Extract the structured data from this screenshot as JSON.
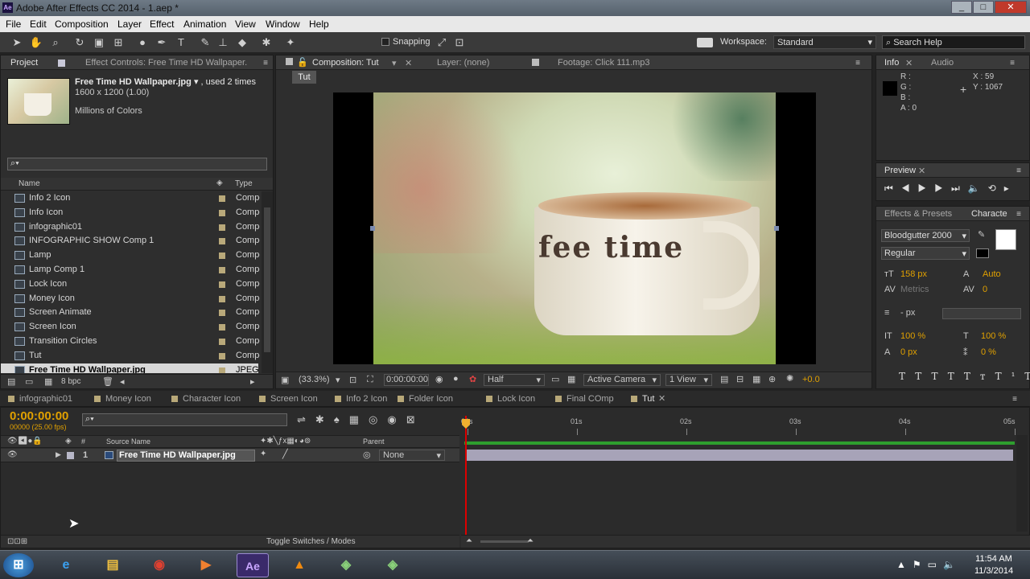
{
  "window": {
    "title": "Adobe After Effects CC 2014 - 1.aep *",
    "app_badge": "Ae"
  },
  "menu": [
    "File",
    "Edit",
    "Composition",
    "Layer",
    "Effect",
    "Animation",
    "View",
    "Window",
    "Help"
  ],
  "toolbar": {
    "snapping": "Snapping",
    "workspace_label": "Workspace:",
    "workspace_value": "Standard",
    "search_placeholder": "Search Help"
  },
  "project_panel": {
    "tabs": [
      "Project",
      "Effect Controls: Free Time HD Wallpaper."
    ],
    "asset": {
      "name": "Free Time HD Wallpaper.jpg",
      "usage": ", used 2 times",
      "dimensions": "1600 x 1200 (1.00)",
      "colors": "Millions of Colors"
    },
    "columns": {
      "name": "Name",
      "type": "Type"
    },
    "items": [
      {
        "name": "Info 2 Icon",
        "type": "Compo"
      },
      {
        "name": "Info Icon",
        "type": "Compo"
      },
      {
        "name": "infographic01",
        "type": "Compo"
      },
      {
        "name": "INFOGRAPHIC SHOW Comp 1",
        "type": "Compo"
      },
      {
        "name": "Lamp",
        "type": "Compo"
      },
      {
        "name": "Lamp Comp 1",
        "type": "Compo"
      },
      {
        "name": "Lock Icon",
        "type": "Compo"
      },
      {
        "name": "Money Icon",
        "type": "Compo"
      },
      {
        "name": "Screen Animate",
        "type": "Compo"
      },
      {
        "name": "Screen Icon",
        "type": "Compo"
      },
      {
        "name": "Transition Circles",
        "type": "Compo"
      },
      {
        "name": "Tut",
        "type": "Compo"
      },
      {
        "name": "Free Time HD Wallpaper.jpg",
        "type": "JPEG"
      }
    ],
    "bpc": "8 bpc"
  },
  "comp_panel": {
    "tabs": [
      "Composition: Tut",
      "Layer: (none)",
      "Footage: Click 111.mp3"
    ],
    "crumb": "Tut",
    "image_text": "fee time",
    "zoom": "(33.3%)",
    "timecode": "0:00:00:00",
    "resolution": "Half",
    "camera": "Active Camera",
    "view": "1 View",
    "exposure": "+0.0"
  },
  "info_panel": {
    "tabs": [
      "Info",
      "Audio"
    ],
    "r": "R :",
    "g": "G :",
    "b": "B :",
    "a": "A : 0",
    "x": "X : 59",
    "y": "Y : 1067"
  },
  "preview_panel": {
    "tab": "Preview"
  },
  "character_panel": {
    "tabs": [
      "Effects & Presets",
      "Characte"
    ],
    "font": "Bloodgutter 2000",
    "style": "Regular",
    "size": "158 px",
    "leading": "Auto",
    "kerning": "Metrics",
    "tracking": "0",
    "stroke": "- px",
    "vscale": "100 %",
    "hscale": "100 %",
    "baseline": "0 px",
    "tsume": "0 %"
  },
  "timeline": {
    "tabs": [
      "infographic01",
      "Money Icon",
      "Character Icon",
      "Screen Icon",
      "Info 2 Icon",
      "Folder Icon",
      "Lock Icon",
      "Final COmp",
      "Tut"
    ],
    "timecode": "0:00:00:00",
    "frames": "00000 (25.00 fps)",
    "col_source": "Source Name",
    "col_parent": "Parent",
    "layer": {
      "num": "1",
      "name": "Free Time HD Wallpaper.jpg",
      "parent": "None"
    },
    "ruler": [
      "00s",
      "01s",
      "02s",
      "03s",
      "04s",
      "05s"
    ],
    "toggle": "Toggle Switches / Modes"
  },
  "taskbar": {
    "time": "11:54 AM",
    "date": "11/3/2014"
  }
}
